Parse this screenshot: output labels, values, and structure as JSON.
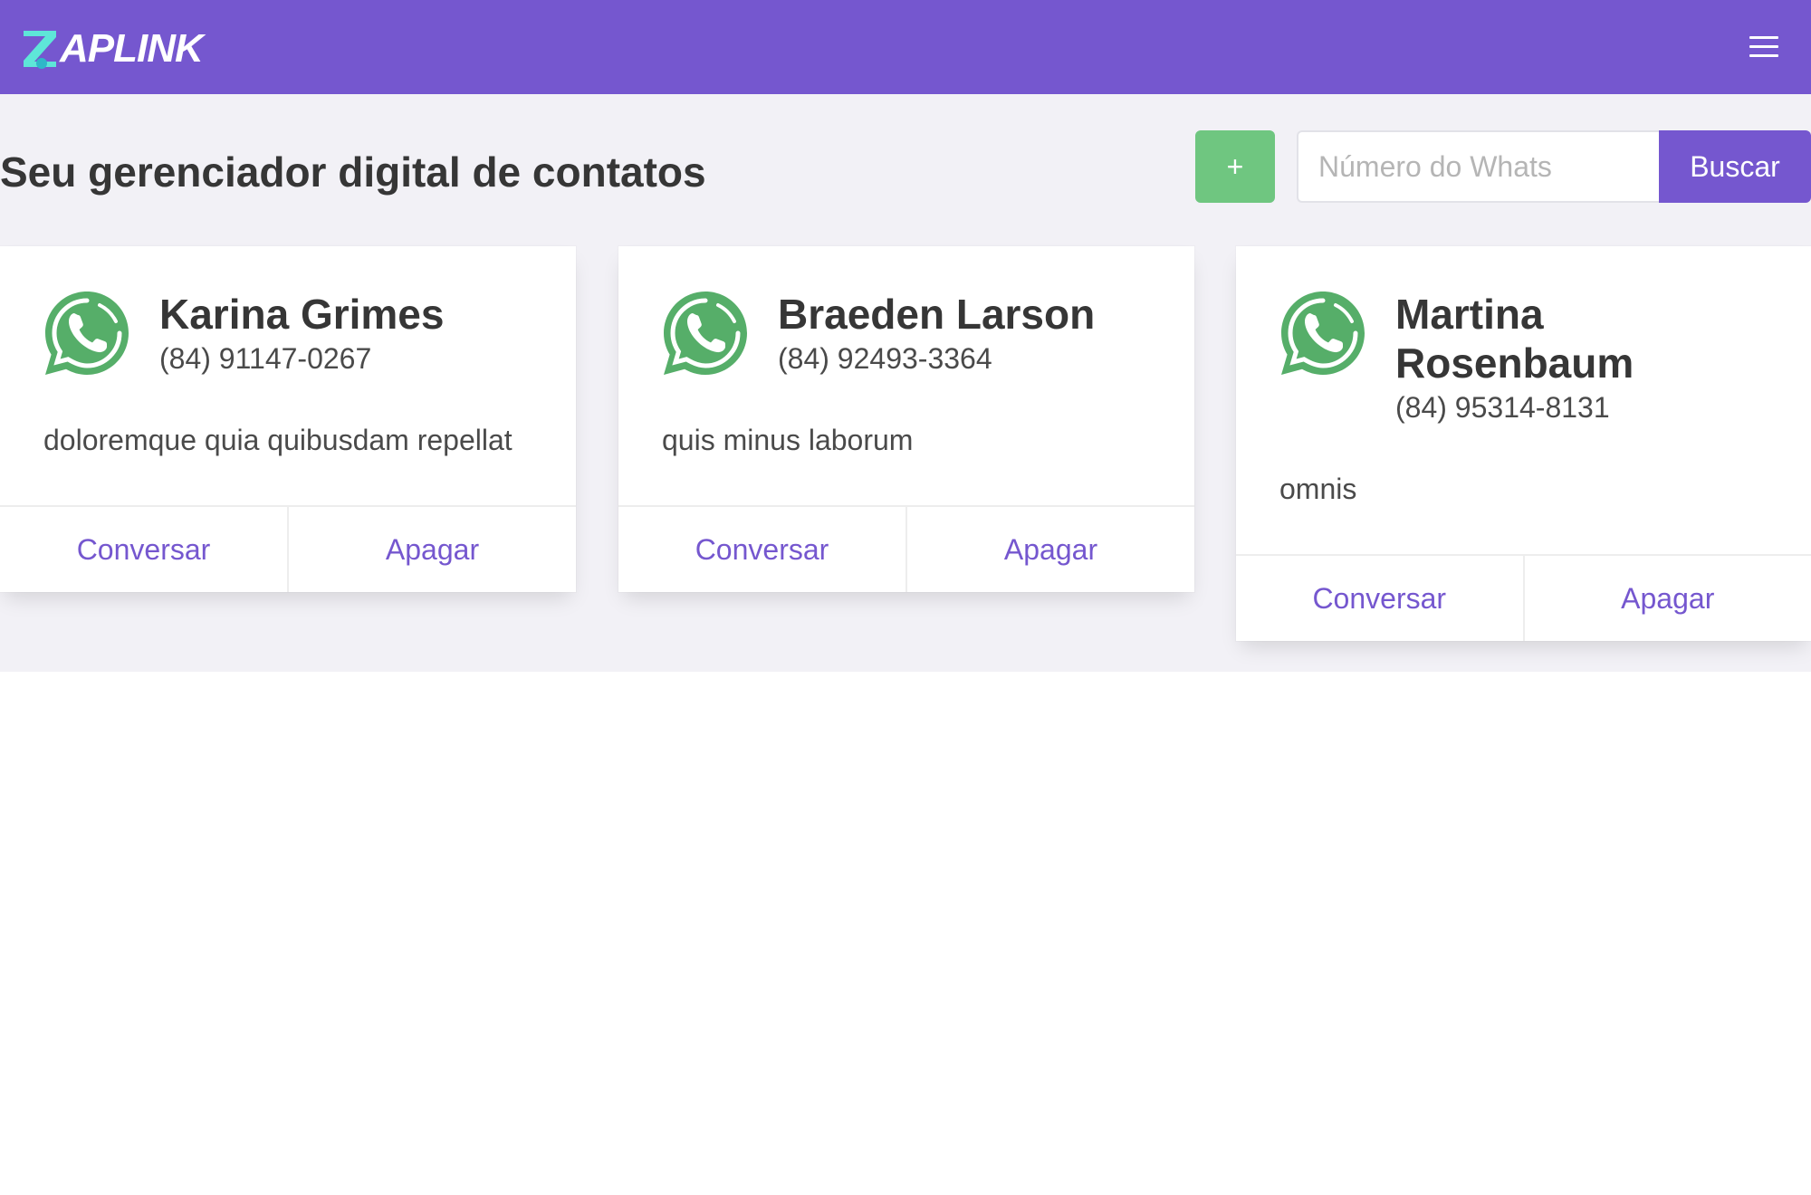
{
  "navbar": {
    "logo_text": "APLINK",
    "brand_color": "#7557cf",
    "logo_accent": "#5ee6d8"
  },
  "header": {
    "title": "Seu gerenciador digital de contatos",
    "add_label": "+",
    "search_placeholder": "Número do Whats",
    "search_value": "",
    "search_button": "Buscar",
    "add_color": "#6fc680"
  },
  "contacts": [
    {
      "name": "Karina Grimes",
      "phone": "(84) 91147-0267",
      "description": "doloremque quia quibusdam repellat",
      "chat_label": "Conversar",
      "delete_label": "Apagar"
    },
    {
      "name": "Braeden Larson",
      "phone": "(84) 92493-3364",
      "description": "quis minus laborum",
      "chat_label": "Conversar",
      "delete_label": "Apagar"
    },
    {
      "name": "Martina Rosenbaum",
      "phone": "(84) 95314-8131",
      "description": "omnis",
      "chat_label": "Conversar",
      "delete_label": "Apagar"
    }
  ],
  "icons": {
    "whatsapp": "whatsapp-icon",
    "menu": "hamburger-menu-icon"
  }
}
